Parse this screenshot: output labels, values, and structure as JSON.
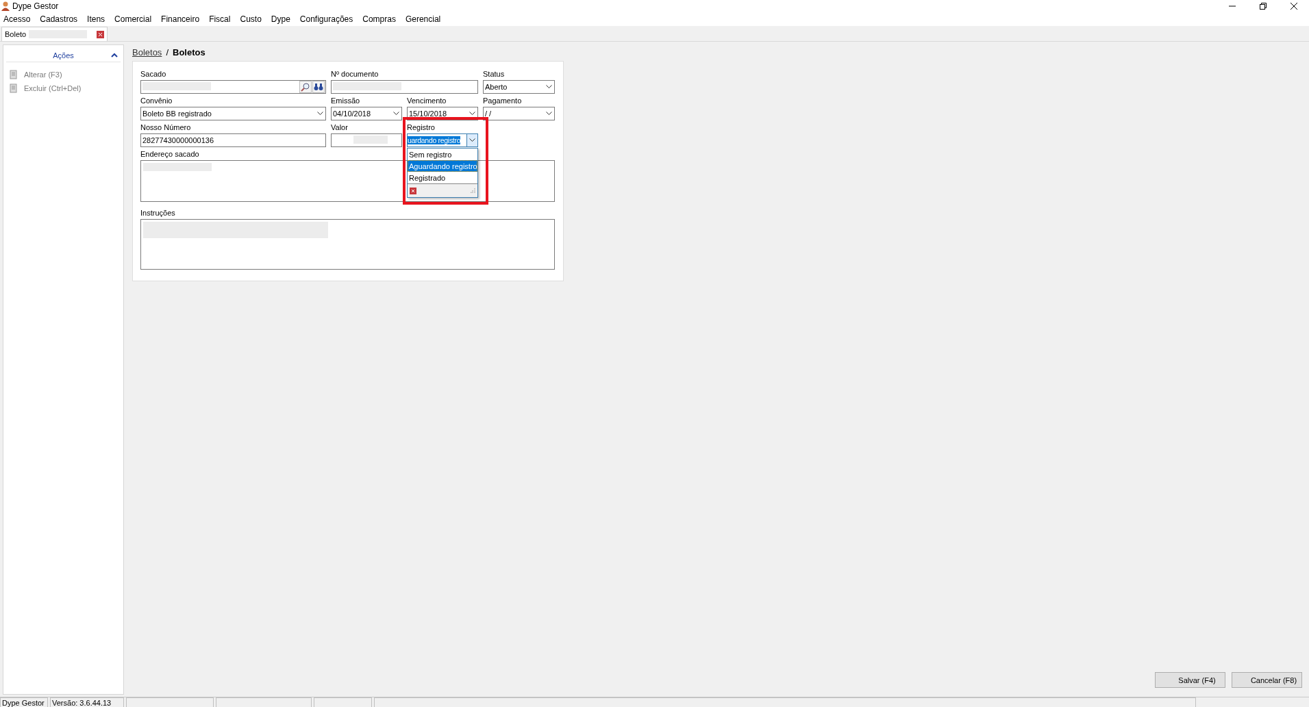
{
  "window": {
    "title": "Dype Gestor"
  },
  "menu": [
    "Acesso",
    "Cadastros",
    "Itens",
    "Comercial",
    "Financeiro",
    "Fiscal",
    "Custo",
    "Dype",
    "Configurações",
    "Compras",
    "Gerencial"
  ],
  "tabs": [
    {
      "label": "Boleto",
      "selected": true
    }
  ],
  "side_panel": {
    "title": "Ações",
    "expanded": true,
    "items": [
      {
        "label": "Alterar (F3)",
        "disabled": true
      },
      {
        "label": "Excluir (Ctrl+Del)",
        "disabled": true
      }
    ]
  },
  "breadcrumb": {
    "link": "Boletos",
    "separator": "/",
    "current": "Boletos"
  },
  "fields": [
    {
      "kind": "lookup",
      "label": "Sacado"
    },
    {
      "kind": "text",
      "label": "Nº documento"
    },
    {
      "kind": "combo",
      "label": "Status",
      "value": "Aberto"
    },
    {
      "kind": "combo",
      "label": "Convênio",
      "value": "Boleto BB registrado"
    },
    {
      "kind": "combo",
      "label": "Emissão",
      "value": "04/10/2018"
    },
    {
      "kind": "combo",
      "label": "Vencimento",
      "value": "15/10/2018"
    },
    {
      "kind": "combo",
      "label": "Pagamento",
      "value": " /  /"
    },
    {
      "kind": "text",
      "label": "Nosso Número",
      "value": "28277430000000136"
    },
    {
      "kind": "text",
      "label": "Valor"
    },
    {
      "kind": "dropdown",
      "label": "Registro",
      "value": "uardando registro",
      "open": true
    },
    {
      "kind": "memo",
      "label": "Endereço sacado"
    },
    {
      "kind": "memo",
      "label": "Instruções"
    }
  ],
  "dropdown_list": {
    "options": [
      {
        "label": "Sem registro",
        "selected": false
      },
      {
        "label": "Aguardando registro",
        "selected": true
      },
      {
        "label": "Registrado",
        "selected": false
      }
    ]
  },
  "buttons": [
    "Salvar (F4)",
    "Cancelar (F8)"
  ],
  "status_bar": [
    "Dype Gestor",
    "Versão: 3.6.44.13"
  ]
}
